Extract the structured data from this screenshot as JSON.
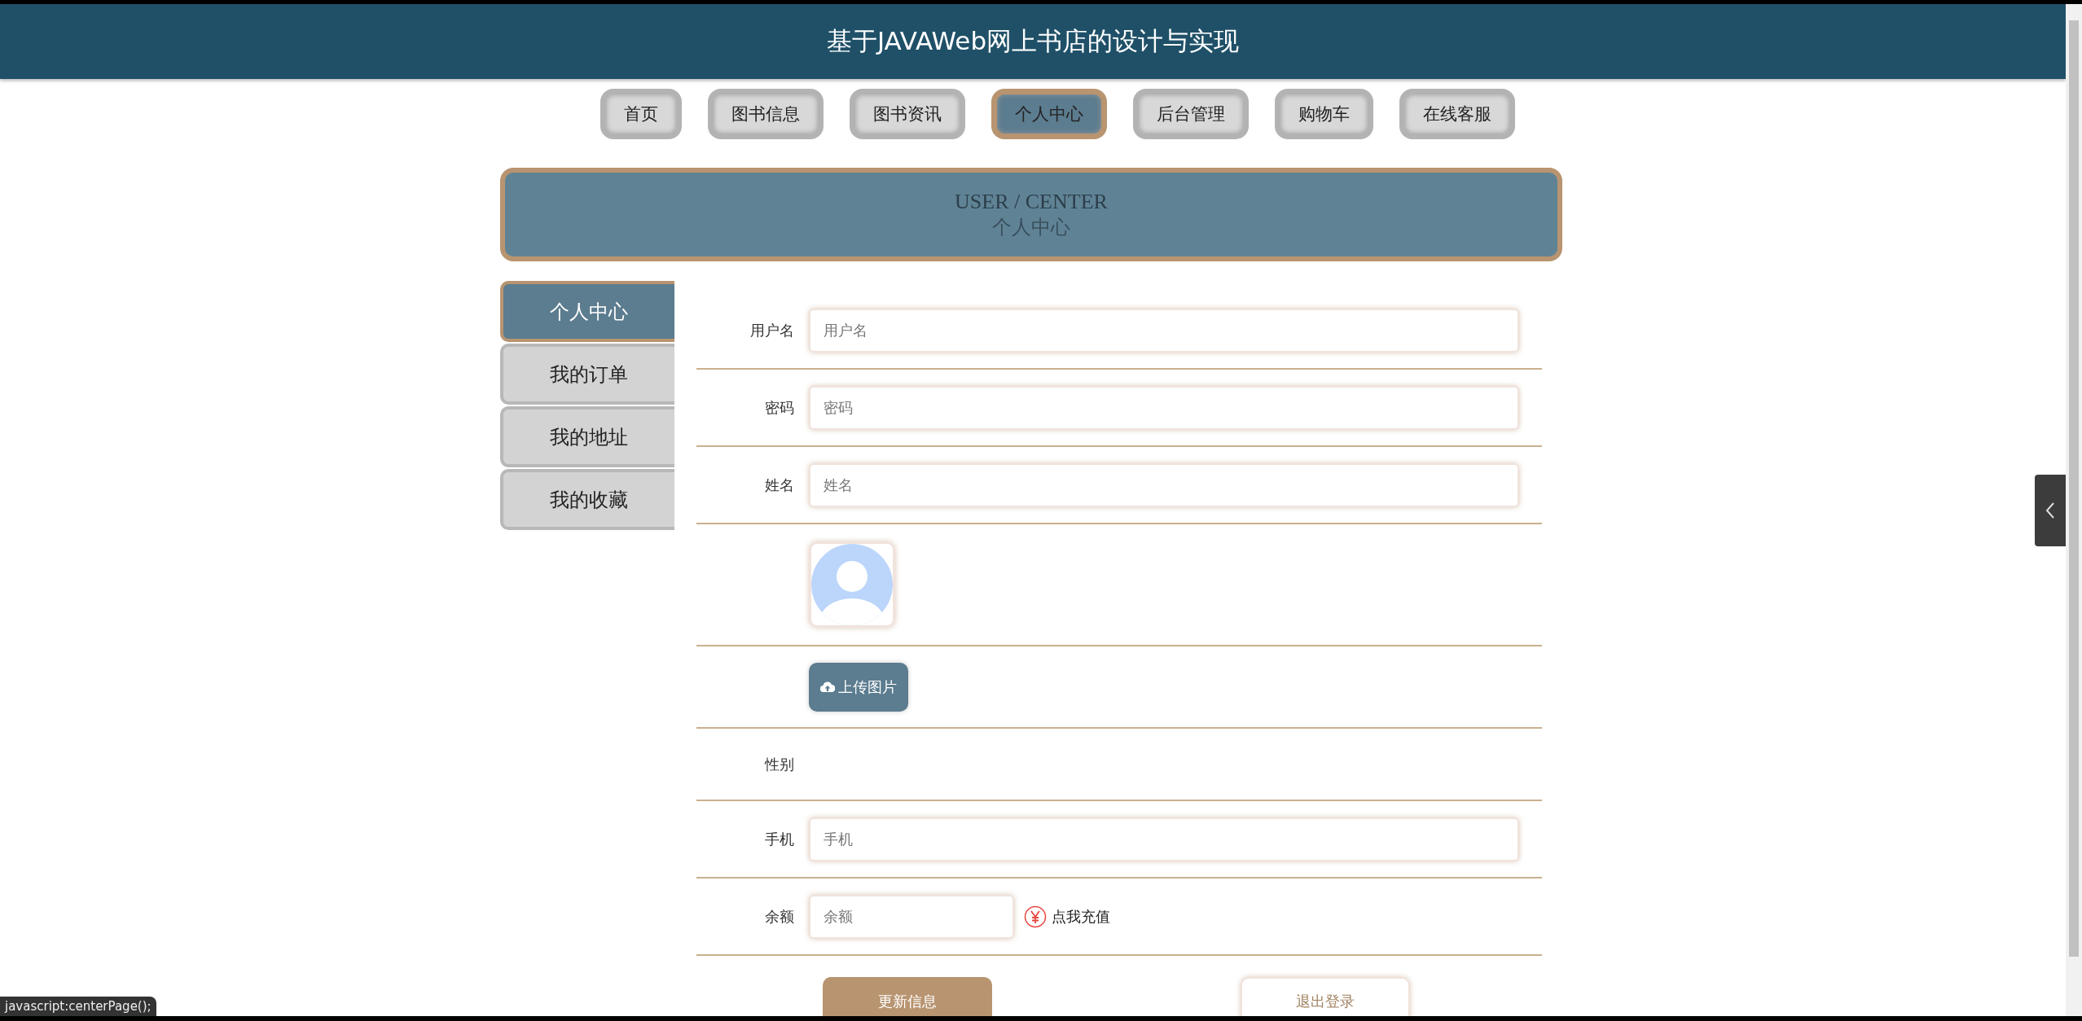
{
  "header": {
    "title": "基于JAVAWeb网上书店的设计与实现"
  },
  "nav": [
    {
      "label": "首页",
      "selected": false
    },
    {
      "label": "图书信息",
      "selected": false
    },
    {
      "label": "图书资讯",
      "selected": false
    },
    {
      "label": "个人中心",
      "selected": true
    },
    {
      "label": "后台管理",
      "selected": false
    },
    {
      "label": "购物车",
      "selected": false
    },
    {
      "label": "在线客服",
      "selected": false
    }
  ],
  "banner": {
    "title_en": "USER / CENTER",
    "title_cn": "个人中心"
  },
  "sidebar": [
    {
      "label": "个人中心",
      "selected": true
    },
    {
      "label": "我的订单",
      "selected": false
    },
    {
      "label": "我的地址",
      "selected": false
    },
    {
      "label": "我的收藏",
      "selected": false
    }
  ],
  "form": [
    {
      "kind": "input",
      "label": "用户名",
      "placeholder": "用户名"
    },
    {
      "kind": "input",
      "label": "密码",
      "placeholder": "密码"
    },
    {
      "kind": "input",
      "label": "姓名",
      "placeholder": "姓名"
    },
    {
      "kind": "avatar"
    },
    {
      "kind": "upload",
      "button": "上传图片"
    },
    {
      "kind": "text",
      "label": "性别"
    },
    {
      "kind": "input",
      "label": "手机",
      "placeholder": "手机"
    },
    {
      "kind": "balance",
      "label": "余额",
      "placeholder": "余额",
      "link": "点我充值"
    }
  ],
  "actions": [
    {
      "label": "更新信息",
      "kind": "primary"
    },
    {
      "label": "退出登录",
      "kind": "plain"
    }
  ],
  "status_bar": "javascript:centerPage();"
}
